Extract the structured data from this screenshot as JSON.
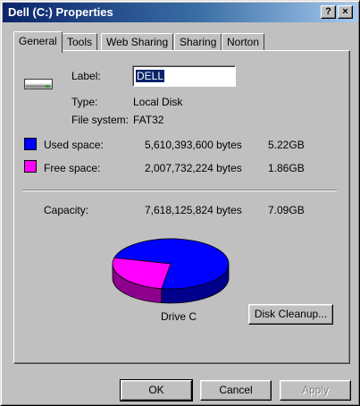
{
  "window": {
    "title": "Dell (C:) Properties",
    "help_button": "?",
    "close_button": "×"
  },
  "tabs": [
    {
      "label": "General",
      "active": true
    },
    {
      "label": "Tools",
      "active": false
    },
    {
      "label": "Web Sharing",
      "active": false
    },
    {
      "label": "Sharing",
      "active": false
    },
    {
      "label": "Norton",
      "active": false
    }
  ],
  "general": {
    "icon": "hard-drive-icon",
    "label_caption": "Label:",
    "label_value": "DELL",
    "type_caption": "Type:",
    "type_value": "Local Disk",
    "fs_caption": "File system:",
    "fs_value": "FAT32",
    "used": {
      "caption": "Used space:",
      "bytes": "5,610,393,600 bytes",
      "size": "5.22GB",
      "color": "#0000ff"
    },
    "free": {
      "caption": "Free space:",
      "bytes": "2,007,732,224 bytes",
      "size": "1.86GB",
      "color": "#ff00ff"
    },
    "capacity": {
      "caption": "Capacity:",
      "bytes": "7,618,125,824 bytes",
      "size": "7.09GB"
    },
    "drive_label": "Drive C",
    "disk_cleanup_label": "Disk Cleanup..."
  },
  "chart_data": {
    "type": "pie",
    "series": [
      {
        "name": "Used space",
        "value": 5610393600,
        "color": "#0000ff"
      },
      {
        "name": "Free space",
        "value": 2007732224,
        "color": "#ff00ff"
      }
    ]
  },
  "buttons": {
    "ok": "OK",
    "cancel": "Cancel",
    "apply": "Apply"
  }
}
